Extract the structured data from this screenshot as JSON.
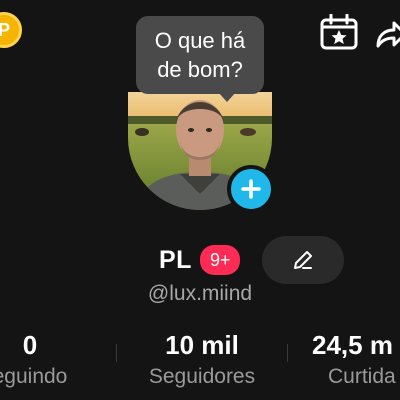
{
  "coin": {
    "symbol": "P"
  },
  "bubble": {
    "text": "O que há de bom?"
  },
  "profile": {
    "name": "PL",
    "badge": "9+",
    "username": "@lux.miind"
  },
  "stats": [
    {
      "value": "0",
      "label": "eguindo"
    },
    {
      "value": "10 mil",
      "label": "Seguidores"
    },
    {
      "value": "24,5 m",
      "label": "Curtida"
    }
  ],
  "colors": {
    "background": "#141414",
    "add_button": "#20b8e8",
    "badge": "#fe2c55",
    "coin": "#f5b400"
  },
  "icons": [
    "coin-icon",
    "calendar-star-icon",
    "share-icon",
    "plus-icon",
    "pencil-icon"
  ]
}
